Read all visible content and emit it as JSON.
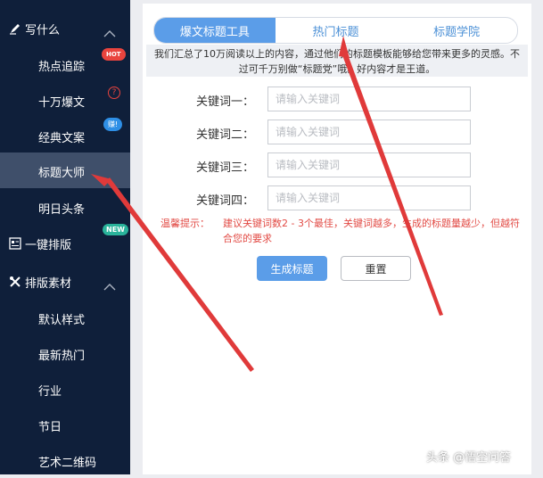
{
  "sidebar": {
    "sections": [
      {
        "label": "写什么",
        "icon": "pen-icon"
      },
      {
        "label": "一键排版",
        "icon": "layout-icon",
        "badge": "NEW"
      },
      {
        "label": "排版素材",
        "icon": "tools-icon"
      }
    ],
    "items": [
      {
        "label": "热点追踪",
        "badge": "HOT"
      },
      {
        "label": "十万爆文",
        "badge": "?"
      },
      {
        "label": "经典文案",
        "badge": "赚!"
      },
      {
        "label": "标题大师"
      },
      {
        "label": "明日头条"
      },
      {
        "label": "默认样式"
      },
      {
        "label": "最新热门"
      },
      {
        "label": "行业"
      },
      {
        "label": "节日"
      },
      {
        "label": "艺术二维码"
      }
    ]
  },
  "tabs": [
    "爆文标题工具",
    "热门标题",
    "标题学院"
  ],
  "notice": "我们汇总了10万阅读以上的内容，通过他们的标题模板能够给您带来更多的灵感。不过可千万别做“标题党”哦。好内容才是王道。",
  "keywords": [
    {
      "label": "关键词一：",
      "placeholder": "请输入关键词"
    },
    {
      "label": "关键词二：",
      "placeholder": "请输入关键词"
    },
    {
      "label": "关键词三：",
      "placeholder": "请输入关键词"
    },
    {
      "label": "关键词四：",
      "placeholder": "请输入关键词"
    }
  ],
  "tip": {
    "label": "温馨提示：",
    "text": "建议关键词数2 - 3个最佳，关键词越多，生成的标题量越少，但越符合您的要求"
  },
  "buttons": {
    "generate": "生成标题",
    "reset": "重置"
  },
  "watermark": "头条 @悟空问答",
  "colors": {
    "sidebar": "#0f1f3a",
    "accent": "#5b9de8",
    "warning": "#e24a44",
    "arrow": "#e03a3a"
  }
}
